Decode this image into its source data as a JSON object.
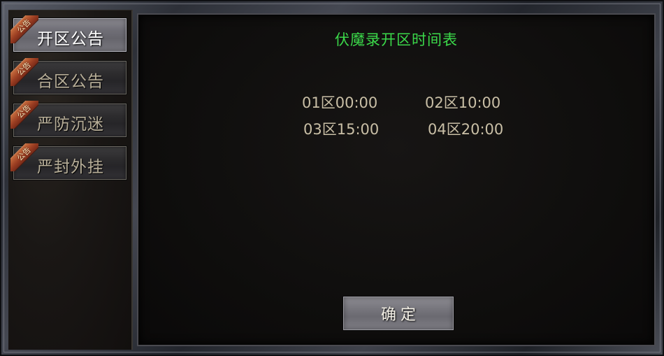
{
  "sidebar": {
    "badge_text": "公告",
    "tabs": [
      {
        "label": "开区公告",
        "active": true
      },
      {
        "label": "合区公告",
        "active": false
      },
      {
        "label": "严防沉迷",
        "active": false
      },
      {
        "label": "严封外挂",
        "active": false
      }
    ]
  },
  "panel": {
    "title": "伏魔录开区时间表",
    "schedule": [
      [
        "01区00:00",
        "02区10:00"
      ],
      [
        "03区15:00",
        "04区20:00"
      ]
    ],
    "confirm_label": "确定"
  },
  "colors": {
    "title": "#3bd94a",
    "schedule_text": "#c9bfa6",
    "badge": "#9a3d22"
  }
}
